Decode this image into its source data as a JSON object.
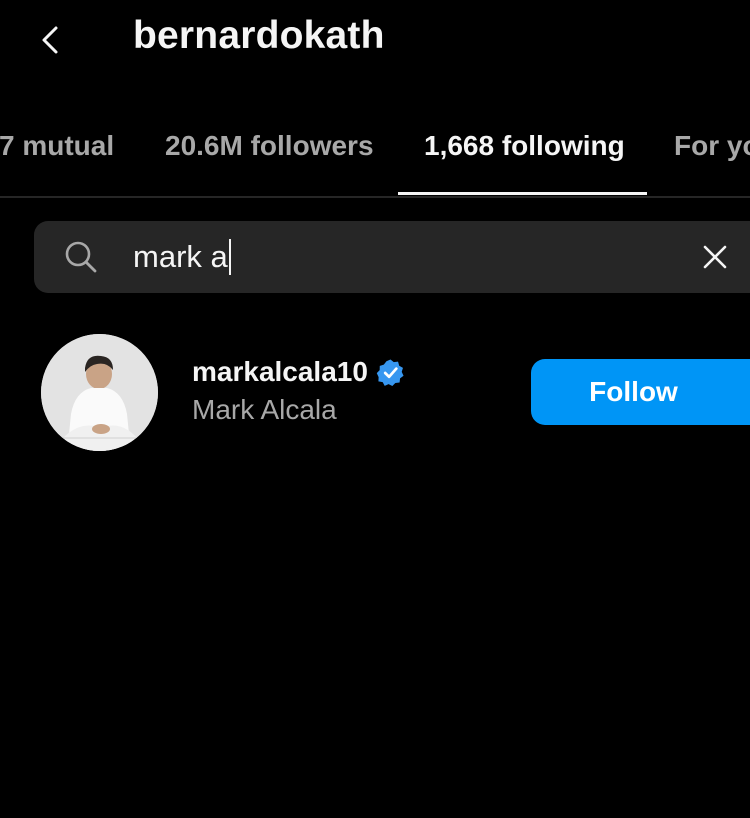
{
  "header": {
    "title": "bernardokath",
    "back_icon": "chevron-left-icon"
  },
  "tabs": [
    {
      "label": "7 mutual",
      "active": false
    },
    {
      "label": "20.6M followers",
      "active": false
    },
    {
      "label": "1,668 following",
      "active": true
    },
    {
      "label": "For yo",
      "active": false
    }
  ],
  "search": {
    "icon": "search-icon",
    "value": "mark a",
    "clear_icon": "close-icon"
  },
  "results": [
    {
      "username": "markalcala10",
      "verified": true,
      "full_name": "Mark Alcala",
      "action_label": "Follow"
    }
  ],
  "colors": {
    "background": "#000000",
    "primary_text": "#f5f5f5",
    "secondary_text": "#a8a8a8",
    "search_bg": "#262626",
    "accent": "#0095f6",
    "verified": "#3797f0"
  }
}
